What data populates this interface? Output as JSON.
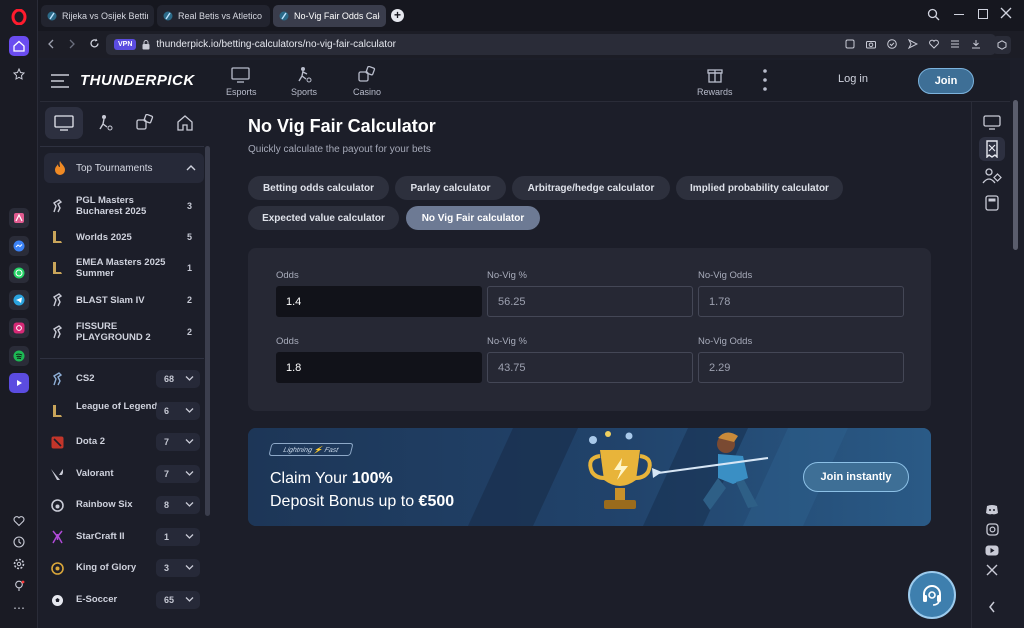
{
  "tabs": [
    {
      "label": "Rijeka vs Osijek Betting Od"
    },
    {
      "label": "Real Betis vs Atletico Madr"
    },
    {
      "label": "No-Vig Fair Odds Calculat",
      "active": true
    }
  ],
  "address": {
    "vpn_label": "VPN",
    "url": "thunderpick.io/betting-calculators/no-vig-fair-calculator"
  },
  "header": {
    "logo_text": "THUNDERPICK",
    "nav": [
      {
        "label": "Esports"
      },
      {
        "label": "Sports"
      },
      {
        "label": "Casino"
      }
    ],
    "rewards_label": "Rewards",
    "login_label": "Log in",
    "join_label": "Join"
  },
  "sidebar": {
    "top_tournaments_label": "Top Tournaments",
    "tournaments": [
      {
        "name": "PGL Masters Bucharest 2025",
        "count": "3"
      },
      {
        "name": "Worlds 2025",
        "count": "5"
      },
      {
        "name": "EMEA Masters 2025 Summer",
        "count": "1"
      },
      {
        "name": "BLAST Slam IV",
        "count": "2"
      },
      {
        "name": "FISSURE PLAYGROUND 2",
        "count": "2"
      }
    ],
    "games": [
      {
        "name": "CS2",
        "count": "68"
      },
      {
        "name": "League of Legends",
        "count": "6"
      },
      {
        "name": "Dota 2",
        "count": "7"
      },
      {
        "name": "Valorant",
        "count": "7"
      },
      {
        "name": "Rainbow Six",
        "count": "8"
      },
      {
        "name": "StarCraft II",
        "count": "1"
      },
      {
        "name": "King of Glory",
        "count": "3"
      },
      {
        "name": "E-Soccer",
        "count": "65"
      }
    ]
  },
  "main": {
    "title": "No Vig Fair Calculator",
    "subtitle": "Quickly calculate the payout for your bets",
    "calculators": [
      {
        "label": "Betting odds calculator"
      },
      {
        "label": "Parlay calculator"
      },
      {
        "label": "Arbitrage/hedge calculator"
      },
      {
        "label": "Implied probability calculator"
      },
      {
        "label": "Expected value calculator"
      },
      {
        "label": "No Vig Fair calculator",
        "active": true
      }
    ],
    "rows": [
      {
        "odds_label": "Odds",
        "odds": "1.4",
        "novig_pct_label": "No-Vig %",
        "novig_pct": "56.25",
        "novig_odds_label": "No-Vig Odds",
        "novig_odds": "1.78"
      },
      {
        "odds_label": "Odds",
        "odds": "1.8",
        "novig_pct_label": "No-Vig %",
        "novig_pct": "43.75",
        "novig_odds_label": "No-Vig Odds",
        "novig_odds": "2.29"
      }
    ],
    "promo": {
      "tag": "Lightning ⚡ Fast",
      "line1_pre": "Claim Your ",
      "line1_bold": "100%",
      "line2_pre": "Deposit Bonus up to ",
      "line2_bold": "€500",
      "button": "Join instantly"
    }
  },
  "colors": {
    "accent": "#3e6f96",
    "background": "#1c1e29",
    "card": "#262834"
  }
}
